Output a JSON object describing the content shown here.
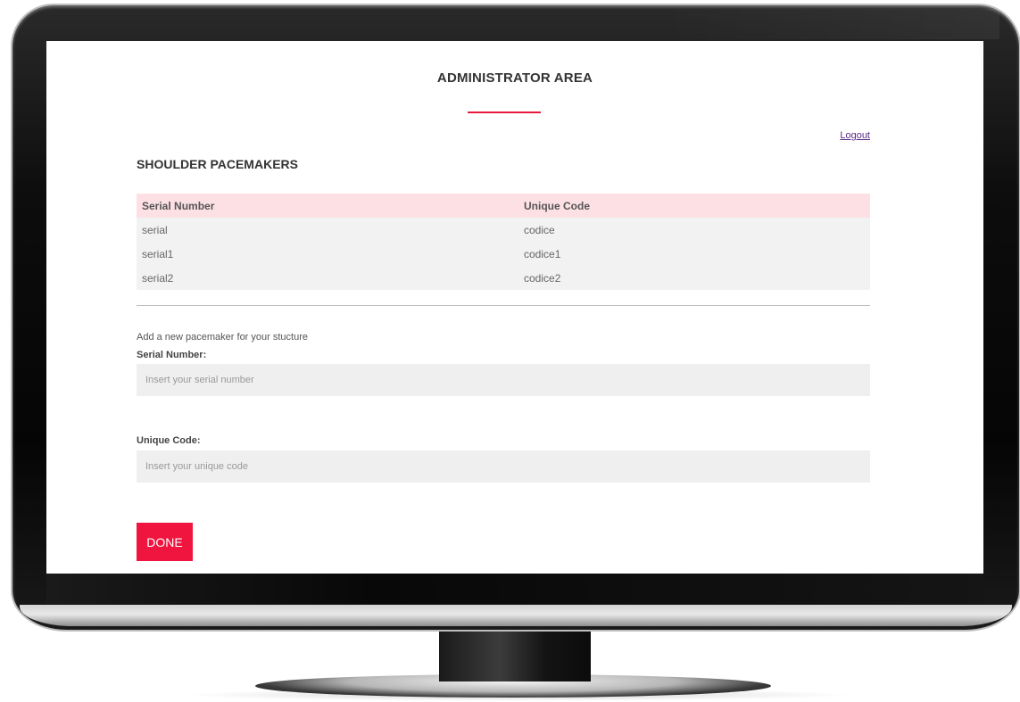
{
  "header": {
    "title": "ADMINISTRATOR AREA",
    "logout_label": "Logout"
  },
  "section": {
    "title": "SHOULDER PACEMAKERS"
  },
  "table": {
    "columns": [
      "Serial Number",
      "Unique Code"
    ],
    "rows": [
      [
        "serial",
        "codice"
      ],
      [
        "serial1",
        "codice1"
      ],
      [
        "serial2",
        "codice2"
      ]
    ]
  },
  "form": {
    "intro": "Add a new pacemaker for your stucture",
    "serial_label": "Serial Number:",
    "serial_value": "",
    "serial_placeholder": "Insert your serial number",
    "code_label": "Unique Code:",
    "code_value": "",
    "code_placeholder": "Insert your unique code",
    "submit_label": "DONE"
  },
  "colors": {
    "accent": "#f0153f",
    "table_header_bg": "#fde0e4",
    "row_bg": "#f2f2f2",
    "link": "#5b2a86"
  }
}
